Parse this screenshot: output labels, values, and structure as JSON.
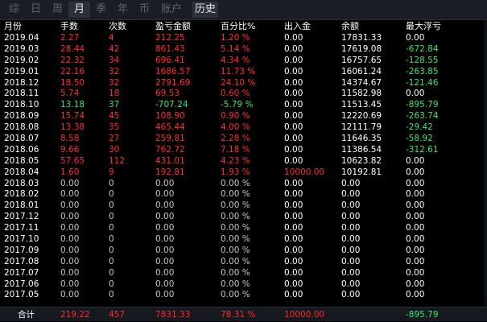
{
  "tabs": [
    {
      "label": "综",
      "active": false
    },
    {
      "label": "日",
      "active": false
    },
    {
      "label": "周",
      "active": false
    },
    {
      "label": "月",
      "active": true
    },
    {
      "label": "季",
      "active": false
    },
    {
      "label": "年",
      "active": false
    },
    {
      "label": "币",
      "active": false
    },
    {
      "label": "账户",
      "active": false
    },
    {
      "label": "历史",
      "active": true
    }
  ],
  "headers": [
    "月份",
    "手数",
    "次数",
    "盈亏金额",
    "百分比%",
    "出入金",
    "余额",
    "最大浮亏"
  ],
  "rows": [
    {
      "month": "2019.04",
      "lots": "2.27",
      "count": "4",
      "pnl": "212.25",
      "pct": "1.20 %",
      "flow": "0.00",
      "balance": "17831.33",
      "maxdd": "0.00",
      "color": "red",
      "ddcolor": "white"
    },
    {
      "month": "2019.03",
      "lots": "28.44",
      "count": "42",
      "pnl": "861.43",
      "pct": "5.14 %",
      "flow": "0.00",
      "balance": "17619.08",
      "maxdd": "-672.84",
      "color": "red",
      "ddcolor": "green"
    },
    {
      "month": "2019.02",
      "lots": "22.32",
      "count": "34",
      "pnl": "696.41",
      "pct": "4.34 %",
      "flow": "0.00",
      "balance": "16757.65",
      "maxdd": "-128.55",
      "color": "red",
      "ddcolor": "green"
    },
    {
      "month": "2019.01",
      "lots": "22.16",
      "count": "32",
      "pnl": "1686.57",
      "pct": "11.73 %",
      "flow": "0.00",
      "balance": "16061.24",
      "maxdd": "-263.85",
      "color": "red",
      "ddcolor": "green"
    },
    {
      "month": "2018.12",
      "lots": "18.50",
      "count": "32",
      "pnl": "2791.69",
      "pct": "24.10 %",
      "flow": "0.00",
      "balance": "14374.67",
      "maxdd": "-121.46",
      "color": "red",
      "ddcolor": "green"
    },
    {
      "month": "2018.11",
      "lots": "5.74",
      "count": "18",
      "pnl": "69.53",
      "pct": "0.60 %",
      "flow": "0.00",
      "balance": "11582.98",
      "maxdd": "0.00",
      "color": "red",
      "ddcolor": "white"
    },
    {
      "month": "2018.10",
      "lots": "13.18",
      "count": "37",
      "pnl": "-707.24",
      "pct": "-5.79 %",
      "flow": "0.00",
      "balance": "11513.45",
      "maxdd": "-895.79",
      "color": "green",
      "ddcolor": "green"
    },
    {
      "month": "2018.09",
      "lots": "15.74",
      "count": "45",
      "pnl": "108.90",
      "pct": "0.90 %",
      "flow": "0.00",
      "balance": "12220.69",
      "maxdd": "-263.74",
      "color": "red",
      "ddcolor": "green"
    },
    {
      "month": "2018.08",
      "lots": "13.38",
      "count": "35",
      "pnl": "465.44",
      "pct": "4.00 %",
      "flow": "0.00",
      "balance": "12111.79",
      "maxdd": "-29.42",
      "color": "red",
      "ddcolor": "green"
    },
    {
      "month": "2018.07",
      "lots": "8.58",
      "count": "27",
      "pnl": "259.81",
      "pct": "2.28 %",
      "flow": "0.00",
      "balance": "11646.35",
      "maxdd": "-58.92",
      "color": "red",
      "ddcolor": "green"
    },
    {
      "month": "2018.06",
      "lots": "9.66",
      "count": "30",
      "pnl": "762.72",
      "pct": "7.18 %",
      "flow": "0.00",
      "balance": "11386.54",
      "maxdd": "-312.61",
      "color": "red",
      "ddcolor": "green"
    },
    {
      "month": "2018.05",
      "lots": "57.65",
      "count": "112",
      "pnl": "431.01",
      "pct": "4.23 %",
      "flow": "0.00",
      "balance": "10623.82",
      "maxdd": "0.00",
      "color": "red",
      "ddcolor": "white"
    },
    {
      "month": "2018.04",
      "lots": "1.60",
      "count": "9",
      "pnl": "192.81",
      "pct": "1.93 %",
      "flow": "10000.00",
      "balance": "10192.81",
      "maxdd": "0.00",
      "color": "red",
      "ddcolor": "white"
    },
    {
      "month": "2018.03",
      "lots": "0.00",
      "count": "0",
      "pnl": "0.00",
      "pct": "0.00 %",
      "flow": "0.00",
      "balance": "0.00",
      "maxdd": "0.00",
      "color": "gray",
      "ddcolor": "white"
    },
    {
      "month": "2018.02",
      "lots": "0.00",
      "count": "0",
      "pnl": "0.00",
      "pct": "0.00 %",
      "flow": "0.00",
      "balance": "0.00",
      "maxdd": "0.00",
      "color": "gray",
      "ddcolor": "white"
    },
    {
      "month": "2018.01",
      "lots": "0.00",
      "count": "0",
      "pnl": "0.00",
      "pct": "0.00 %",
      "flow": "0.00",
      "balance": "0.00",
      "maxdd": "0.00",
      "color": "gray",
      "ddcolor": "white"
    },
    {
      "month": "2017.12",
      "lots": "0.00",
      "count": "0",
      "pnl": "0.00",
      "pct": "0.00 %",
      "flow": "0.00",
      "balance": "0.00",
      "maxdd": "0.00",
      "color": "gray",
      "ddcolor": "white"
    },
    {
      "month": "2017.11",
      "lots": "0.00",
      "count": "0",
      "pnl": "0.00",
      "pct": "0.00 %",
      "flow": "0.00",
      "balance": "0.00",
      "maxdd": "0.00",
      "color": "gray",
      "ddcolor": "white"
    },
    {
      "month": "2017.10",
      "lots": "0.00",
      "count": "0",
      "pnl": "0.00",
      "pct": "0.00 %",
      "flow": "0.00",
      "balance": "0.00",
      "maxdd": "0.00",
      "color": "gray",
      "ddcolor": "white"
    },
    {
      "month": "2017.09",
      "lots": "0.00",
      "count": "0",
      "pnl": "0.00",
      "pct": "0.00 %",
      "flow": "0.00",
      "balance": "0.00",
      "maxdd": "0.00",
      "color": "gray",
      "ddcolor": "white"
    },
    {
      "month": "2017.08",
      "lots": "0.00",
      "count": "0",
      "pnl": "0.00",
      "pct": "0.00 %",
      "flow": "0.00",
      "balance": "0.00",
      "maxdd": "0.00",
      "color": "gray",
      "ddcolor": "white"
    },
    {
      "month": "2017.07",
      "lots": "0.00",
      "count": "0",
      "pnl": "0.00",
      "pct": "0.00 %",
      "flow": "0.00",
      "balance": "0.00",
      "maxdd": "0.00",
      "color": "gray",
      "ddcolor": "white"
    },
    {
      "month": "2017.06",
      "lots": "0.00",
      "count": "0",
      "pnl": "0.00",
      "pct": "0.00 %",
      "flow": "0.00",
      "balance": "0.00",
      "maxdd": "0.00",
      "color": "gray",
      "ddcolor": "white"
    },
    {
      "month": "2017.05",
      "lots": "0.00",
      "count": "0",
      "pnl": "0.00",
      "pct": "0.00 %",
      "flow": "0.00",
      "balance": "0.00",
      "maxdd": "0.00",
      "color": "gray",
      "ddcolor": "white"
    }
  ],
  "total": {
    "label": "合计",
    "lots": "219.22",
    "count": "457",
    "pnl": "7831.33",
    "pct": "78.31 %",
    "flow": "10000.00",
    "maxdd": "-895.79"
  }
}
